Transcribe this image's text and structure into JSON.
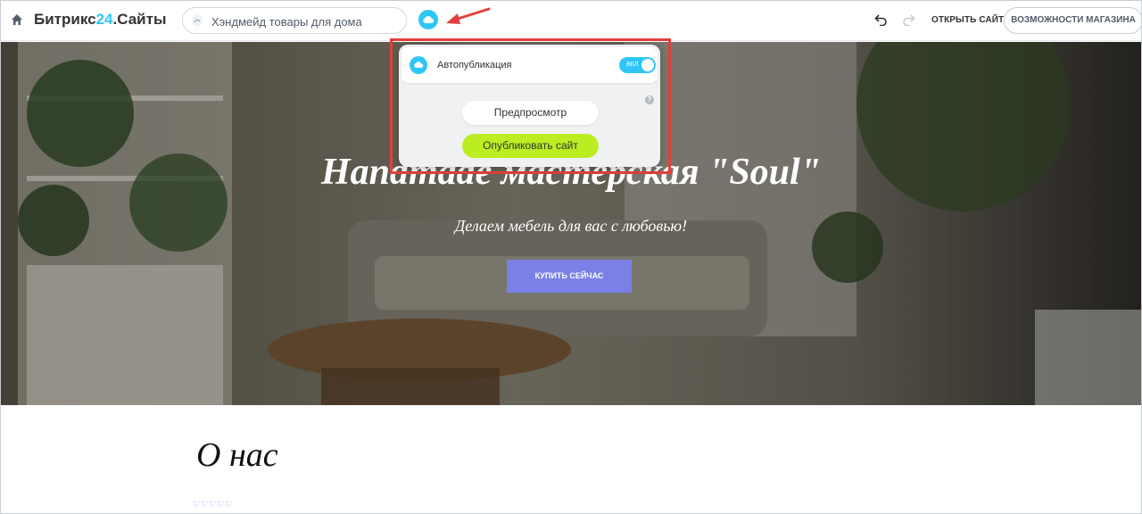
{
  "app": {
    "logo_text": "Битрикс",
    "logo_accent": "24",
    "logo_suffix": ".Сайты"
  },
  "header": {
    "site_name": "Хэндмейд товары для дома",
    "open_site_label": "ОТКРЫТЬ САЙТ",
    "shop_features_label": "ВОЗМОЖНОСТИ МАГАЗИНА"
  },
  "publish_popup": {
    "autopublish_label": "Автопубликация",
    "toggle_state": "ВКЛ",
    "help_symbol": "?",
    "preview_label": "Предпросмотр",
    "publish_label": "Опубликовать сайт"
  },
  "hero": {
    "title": "Hand​made мастерская \"Soul\"",
    "title_visible": "Handmade мастерская \"Soul\"",
    "subtitle": "Делаем мебель для вас с любовью!",
    "buy_label": "КУПИТЬ СЕЙЧАС"
  },
  "about": {
    "title": "О нас",
    "decoration": "♡♡♡♡♡"
  },
  "colors": {
    "accent": "#2fc6f6",
    "publish": "#bbed21",
    "buy_button": "#7a80e6",
    "highlight": "#e3403c"
  }
}
